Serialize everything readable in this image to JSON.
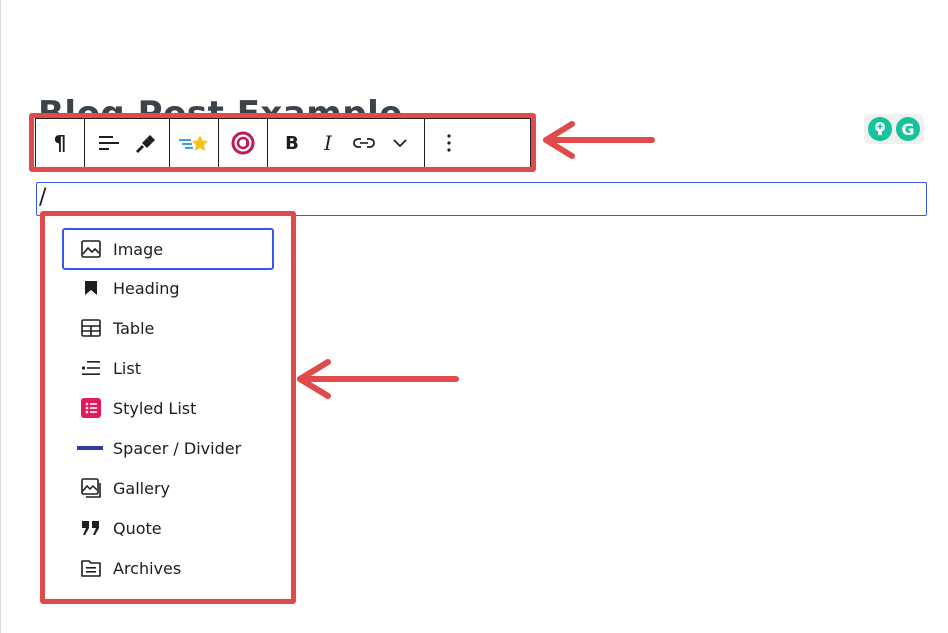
{
  "editor": {
    "title_text": "Blog Post Example",
    "paragraph_value": "/"
  },
  "toolbar": {
    "items": [
      {
        "name": "paragraph",
        "icon": "pilcrow-icon",
        "glyph": "¶"
      },
      {
        "name": "align",
        "icon": "align-left-icon"
      },
      {
        "name": "styles",
        "icon": "paint-brush-icon"
      },
      {
        "name": "ai-writer",
        "icon": "shooting-star-icon"
      },
      {
        "name": "ai-assistant",
        "icon": "ai-circle-icon",
        "glyph": "@"
      },
      {
        "name": "bold",
        "label": "B"
      },
      {
        "name": "italic",
        "label": "I"
      },
      {
        "name": "link",
        "icon": "link-icon"
      },
      {
        "name": "more-format",
        "icon": "chevron-down-icon"
      },
      {
        "name": "options",
        "icon": "vertical-ellipsis-icon"
      }
    ]
  },
  "inserter": {
    "items": [
      {
        "label": "Image",
        "icon": "image-icon",
        "selected": true
      },
      {
        "label": "Heading",
        "icon": "bookmark-icon"
      },
      {
        "label": "Table",
        "icon": "table-icon"
      },
      {
        "label": "List",
        "icon": "list-icon"
      },
      {
        "label": "Styled List",
        "icon": "styled-list-icon"
      },
      {
        "label": "Spacer / Divider",
        "icon": "divider-icon"
      },
      {
        "label": "Gallery",
        "icon": "gallery-icon"
      },
      {
        "label": "Quote",
        "icon": "quote-icon"
      },
      {
        "label": "Archives",
        "icon": "archive-icon"
      }
    ]
  },
  "grammarly": {
    "logo_letter": "G"
  },
  "colors": {
    "annotation_red": "#e04a4a",
    "wp_blue": "#3858e9",
    "grammarly_green": "#15c39a",
    "styled_list_pink": "#e5195e",
    "divider_blue": "#2b3aa8"
  }
}
